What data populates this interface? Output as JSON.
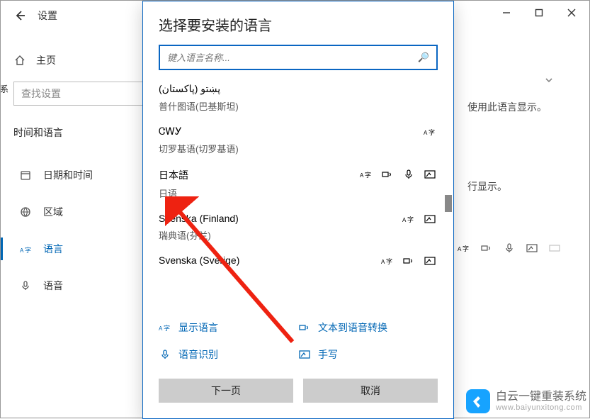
{
  "titlebar": {
    "settings_label": "设置"
  },
  "sidebar": {
    "home_label": "主页",
    "search_placeholder": "查找设置",
    "section_label": "时间和语言",
    "items": [
      {
        "label": "日期和时间",
        "active": false
      },
      {
        "label": "区域",
        "active": false
      },
      {
        "label": "语言",
        "active": true
      },
      {
        "label": "语音",
        "active": false
      }
    ]
  },
  "right_partial": {
    "line1": "使用此语言显示。",
    "line2": "行显示。"
  },
  "modal": {
    "title": "选择要安装的语言",
    "search_placeholder": "键入语言名称...",
    "languages": [
      {
        "native": "پښتو (پاکستان)",
        "local": "普什图语(巴基斯坦)",
        "features": []
      },
      {
        "native": "ᏣᎳᎩ",
        "local": "切罗基语(切罗基语)",
        "features": [
          "display"
        ]
      },
      {
        "native": "日本語",
        "local": "日语",
        "features": [
          "display",
          "tts",
          "speech",
          "hand"
        ]
      },
      {
        "native": "Svenska (Finland)",
        "local": "瑞典语(芬兰)",
        "features": [
          "display",
          "hand"
        ]
      },
      {
        "native": "Svenska (Sverige)",
        "local": "",
        "features": [
          "display",
          "tts",
          "hand"
        ]
      }
    ],
    "legend": {
      "display": "显示语言",
      "tts": "文本到语音转换",
      "speech": "语音识别",
      "hand": "手写"
    },
    "buttons": {
      "next": "下一页",
      "cancel": "取消"
    }
  },
  "watermark": {
    "title": "白云一键重装系统",
    "url": "www.baiyunxitong.com"
  },
  "partial_left_char": "系"
}
